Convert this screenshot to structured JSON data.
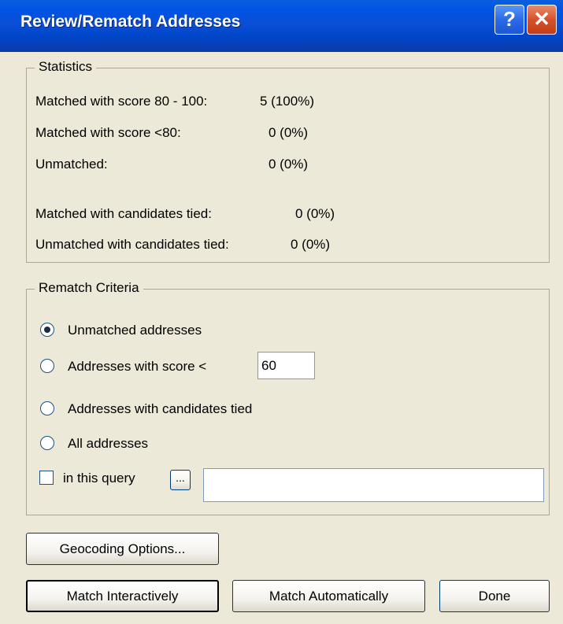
{
  "window": {
    "title": "Review/Rematch Addresses",
    "help_icon": "question-mark-icon",
    "close_icon": "close-x-icon",
    "help_glyph": "?",
    "close_glyph": "✕"
  },
  "statistics": {
    "title": "Statistics",
    "rows": [
      {
        "label": "Matched with score 80 - 100:",
        "value": "5  (100%)"
      },
      {
        "label": "Matched with score <80:",
        "value": "0  (0%)"
      },
      {
        "label": "Unmatched:",
        "value": "0  (0%)"
      },
      {
        "label": "Matched with candidates tied:",
        "value": "0  (0%)"
      },
      {
        "label": "Unmatched with candidates tied:",
        "value": "0  (0%)"
      }
    ]
  },
  "rematch": {
    "title": "Rematch Criteria",
    "options": [
      {
        "label": "Unmatched addresses",
        "checked": true
      },
      {
        "label": "Addresses with score <",
        "checked": false
      },
      {
        "label": "Addresses with candidates tied",
        "checked": false
      },
      {
        "label": "All addresses",
        "checked": false
      }
    ],
    "score_value": "60",
    "query_label": "in this query",
    "query_checked": false,
    "query_button": "...",
    "query_value": ""
  },
  "buttons": {
    "geocoding_options": "Geocoding Options...",
    "match_interactively": "Match Interactively",
    "match_automatically": "Match Automatically",
    "done": "Done"
  }
}
